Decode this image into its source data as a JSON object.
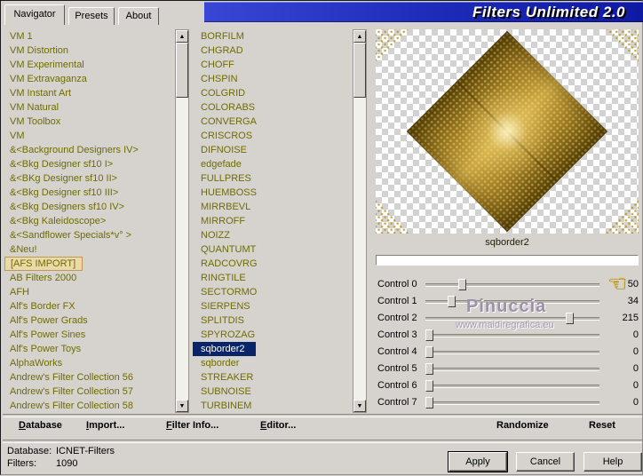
{
  "window": {
    "title": "Filters Unlimited 2.0"
  },
  "tabs": [
    {
      "label": "Navigator",
      "active": true
    },
    {
      "label": "Presets",
      "active": false
    },
    {
      "label": "About",
      "active": false
    }
  ],
  "category_list": {
    "focused": "[AFS IMPORT]",
    "items": [
      "VM 1",
      "VM Distortion",
      "VM Experimental",
      "VM Extravaganza",
      "VM Instant Art",
      "VM Natural",
      "VM Toolbox",
      "VM",
      "&<Background Designers IV>",
      "&<Bkg Designer sf10 I>",
      "&<BKg Designer sf10 II>",
      "&<Bkg Designer sf10 III>",
      "&<Bkg Designers sf10 IV>",
      "&<Bkg Kaleidoscope>",
      "&<Sandflower Specials*v° >",
      "&Neu!",
      "[AFS IMPORT]",
      "AB Filters 2000",
      "AFH",
      "Alf's Border FX",
      "Alf's Power Grads",
      "Alf's Power Sines",
      "Alf's Power Toys",
      "AlphaWorks",
      "Andrew's Filter Collection 56",
      "Andrew's Filter Collection 57",
      "Andrew's Filter Collection 58"
    ]
  },
  "filter_list": {
    "selected": "sqborder2",
    "items": [
      "BORFILM",
      "CHGRAD",
      "CHOFF",
      "CHSPIN",
      "COLGRID",
      "COLORABS",
      "CONVERGA",
      "CRISCROS",
      "DIFNOISE",
      "edgefade",
      "FULLPRES",
      "HUEMBOSS",
      "MIRRBEVL",
      "MIRROFF",
      "NOIZZ",
      "QUANTUMT",
      "RADCOVRG",
      "RINGTILE",
      "SECTORMO",
      "SIERPENS",
      "SPLITDIS",
      "SPYROZAG",
      "sqborder2",
      "sqborder",
      "STREAKER",
      "SUBNOISE",
      "TURBINEM"
    ]
  },
  "preview": {
    "filter_name": "sqborder2",
    "progress_value": 0
  },
  "controls": [
    {
      "label": "Control 0",
      "value": 50
    },
    {
      "label": "Control 1",
      "value": 34
    },
    {
      "label": "Control 2",
      "value": 215
    },
    {
      "label": "Control 3",
      "value": 0
    },
    {
      "label": "Control 4",
      "value": 0
    },
    {
      "label": "Control 5",
      "value": 0
    },
    {
      "label": "Control 6",
      "value": 0
    },
    {
      "label": "Control 7",
      "value": 0
    }
  ],
  "watermark": {
    "line1": "Pinuccia",
    "line2": "www.maidiregrafica.eu"
  },
  "command_buttons": [
    "Database",
    "Import...",
    "Filter Info...",
    "Editor..."
  ],
  "right_buttons": [
    "Randomize",
    "Reset"
  ],
  "status": {
    "database_label": "Database:",
    "database_value": "ICNET-Filters",
    "filters_label": "Filters:",
    "filters_value": "1090"
  },
  "dialog_buttons": [
    "Apply",
    "Cancel",
    "Help"
  ],
  "icons": {
    "hand_pointer": "☜",
    "scroll_up": "▲",
    "scroll_down": "▼"
  },
  "colors": {
    "title_blue": "#1d2ab8",
    "selection_blue": "#0a246a",
    "list_text_olive": "#6d6d00",
    "gold": "#cfac46"
  }
}
